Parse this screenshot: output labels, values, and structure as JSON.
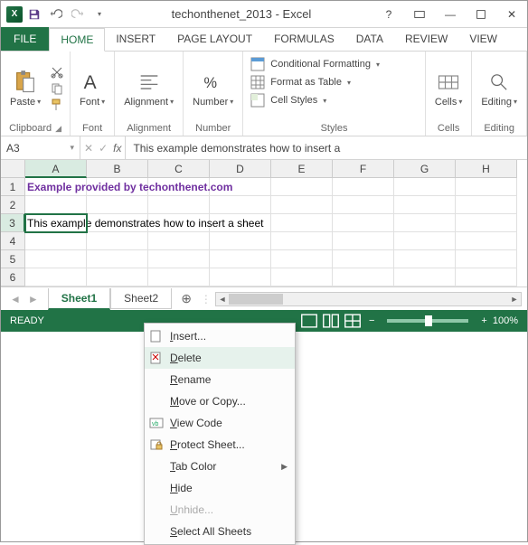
{
  "title": "techonthenet_2013 - Excel",
  "ribbon_tabs": {
    "file": "FILE",
    "home": "HOME",
    "insert": "INSERT",
    "page_layout": "PAGE LAYOUT",
    "formulas": "FORMULAS",
    "data": "DATA",
    "review": "REVIEW",
    "view": "VIEW"
  },
  "ribbon": {
    "clipboard": {
      "label": "Clipboard",
      "paste": "Paste"
    },
    "font": {
      "label": "Font",
      "btn": "Font"
    },
    "alignment": {
      "label": "Alignment",
      "btn": "Alignment"
    },
    "number": {
      "label": "Number",
      "btn": "Number"
    },
    "styles": {
      "label": "Styles",
      "cond": "Conditional Formatting",
      "table": "Format as Table",
      "cell": "Cell Styles"
    },
    "cells": {
      "label": "Cells",
      "btn": "Cells"
    },
    "editing": {
      "label": "Editing",
      "btn": "Editing"
    }
  },
  "namebox": "A3",
  "formula": "This example demonstrates how to insert a",
  "columns": [
    "A",
    "B",
    "C",
    "D",
    "E",
    "F",
    "G",
    "H"
  ],
  "rows": [
    "1",
    "2",
    "3",
    "4",
    "5",
    "6"
  ],
  "cells": {
    "A1": "Example provided by techonthenet.com",
    "A3": "This example demonstrates how to insert a sheet"
  },
  "sheets": {
    "s1": "Sheet1",
    "s2": "Sheet2"
  },
  "status": {
    "ready": "READY",
    "zoom": "100%"
  },
  "ctx": {
    "insert_u": "I",
    "insert": "nsert...",
    "delete_u": "D",
    "delete": "elete",
    "rename_u": "R",
    "rename": "ename",
    "move_u": "M",
    "move": "ove or Copy...",
    "view_u": "V",
    "view": "iew Code",
    "protect_u": "P",
    "protect": "rotect Sheet...",
    "tab_u": "T",
    "tab": "ab Color",
    "hide_u": "H",
    "hide": "ide",
    "unhide_u": "U",
    "unhide": "nhide...",
    "select_u": "S",
    "select": "elect All Sheets"
  }
}
